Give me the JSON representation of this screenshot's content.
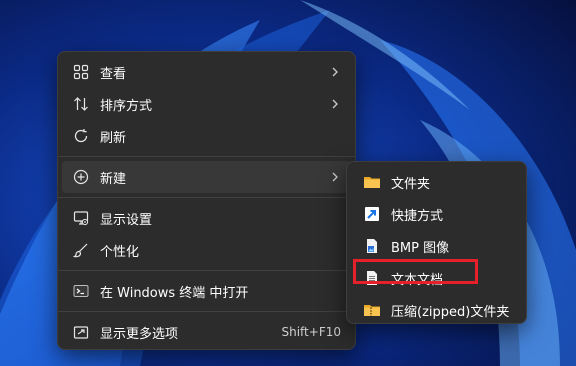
{
  "main_menu": {
    "items": [
      {
        "label": "查看",
        "icon": "grid-icon"
      },
      {
        "label": "排序方式",
        "icon": "sort-icon"
      },
      {
        "label": "刷新",
        "icon": "refresh-icon"
      },
      {
        "label": "新建",
        "icon": "plus-circle-icon"
      },
      {
        "label": "显示设置",
        "icon": "display-icon"
      },
      {
        "label": "个性化",
        "icon": "brush-icon"
      },
      {
        "label": "在 Windows 终端 中打开",
        "icon": "terminal-icon"
      },
      {
        "label": "显示更多选项",
        "icon": "share-icon",
        "shortcut": "Shift+F10"
      }
    ]
  },
  "sub_menu": {
    "items": [
      {
        "label": "文件夹",
        "icon": "folder-icon"
      },
      {
        "label": "快捷方式",
        "icon": "shortcut-icon"
      },
      {
        "label": "BMP 图像",
        "icon": "bmp-file-icon"
      },
      {
        "label": "文本文档",
        "icon": "text-file-icon"
      },
      {
        "label": "压缩(zipped)文件夹",
        "icon": "zip-folder-icon"
      }
    ]
  },
  "colors": {
    "menu_bg": "#2c2c2c",
    "hover_bg": "#383838",
    "highlight_border": "#e5202a",
    "folder": "#f8c44f",
    "accent_blue": "#3aa0ff"
  }
}
